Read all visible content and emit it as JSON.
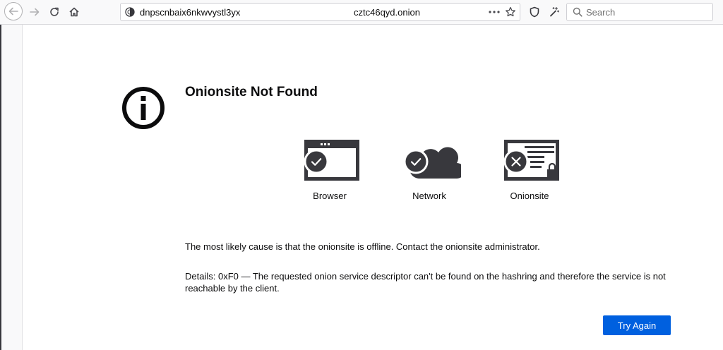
{
  "toolbar": {
    "url_prefix": "dnpscnbaix6nkwvystl3yx",
    "url_suffix": "cztc46qyd.onion",
    "search_placeholder": "Search",
    "icons": [
      "back-icon",
      "forward-icon",
      "reload-icon",
      "home-icon",
      "onion-identity-icon",
      "page-actions-icon",
      "bookmark-star-icon",
      "shield-icon",
      "magic-wand-icon",
      "search-icon"
    ]
  },
  "error": {
    "title": "Onionsite Not Found",
    "diagram": [
      {
        "label": "Browser",
        "status": "ok",
        "icon": "browser-window-icon"
      },
      {
        "label": "Network",
        "status": "ok",
        "icon": "cloud-icon"
      },
      {
        "label": "Onionsite",
        "status": "error",
        "icon": "onionsite-server-icon"
      }
    ],
    "cause": "The most likely cause is that the onionsite is offline. Contact the onionsite administrator.",
    "details": "Details: 0xF0 — The requested onion service descriptor can't be found on the hashring and therefore the service is not reachable by the client.",
    "try_again_label": "Try Again"
  },
  "colors": {
    "accent": "#0060df",
    "icon_dark": "#38383d",
    "toolbar_bg": "#f9f9fa"
  }
}
